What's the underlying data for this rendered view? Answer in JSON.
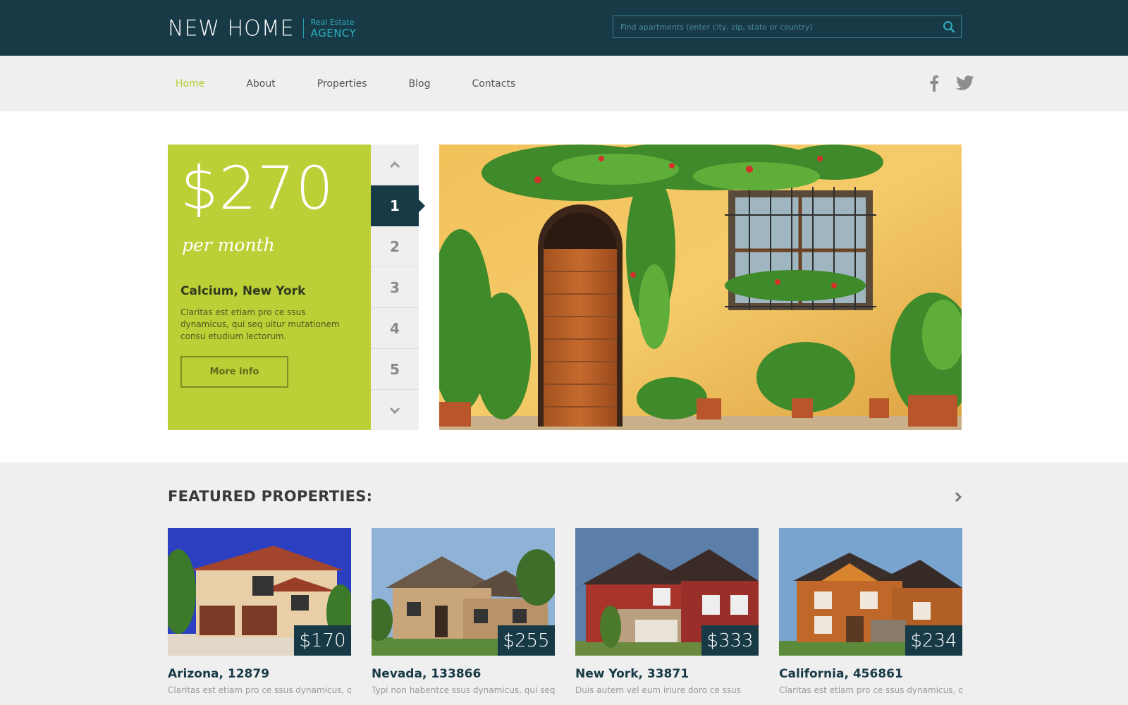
{
  "header": {
    "logo_main": "NEW HOME",
    "logo_sub_line1": "Real Estate",
    "logo_sub_line2": "AGENCY",
    "search_placeholder": "Find apartments (enter city, zip, state or country)"
  },
  "nav": {
    "items": [
      {
        "label": "Home",
        "active": true
      },
      {
        "label": "About"
      },
      {
        "label": "Properties"
      },
      {
        "label": "Blog"
      },
      {
        "label": "Contacts"
      }
    ],
    "social_icons": [
      "facebook-icon",
      "twitter-icon"
    ]
  },
  "hero": {
    "price": "$270",
    "per": "per month",
    "location": "Calcium, New York",
    "description": "Claritas est etiam pro ce ssus dynamicus, qui seq uitur mutationem consu etudium lectorum.",
    "button_label": "More info",
    "pager": [
      "1",
      "2",
      "3",
      "4",
      "5"
    ],
    "active_page": "1"
  },
  "featured": {
    "title": "FEATURED PROPERTIES:",
    "cards": [
      {
        "price": "$170",
        "title": "Arizona, 12879",
        "text": "Claritas est etiam pro ce ssus dynamicus, qui"
      },
      {
        "price": "$255",
        "title": "Nevada, 133866",
        "text": "Typi non habentce ssus dynamicus, qui seq"
      },
      {
        "price": "$333",
        "title": "New York, 33871",
        "text": "Duis autem vel eum iriure doro ce ssus"
      },
      {
        "price": "$234",
        "title": "California, 456861",
        "text": "Claritas est etiam pro ce ssus dynamicus, qui"
      }
    ]
  },
  "colors": {
    "header_bg": "#173a46",
    "accent_green": "#bccf36",
    "nav_bg": "#efefef",
    "link_active": "#b5cc2e"
  }
}
